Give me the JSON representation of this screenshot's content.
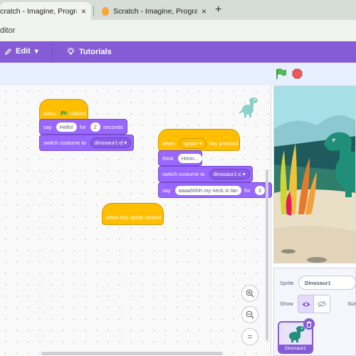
{
  "browser": {
    "tabs": [
      {
        "title": "cratch - Imagine, Program, Sh",
        "close": "×"
      },
      {
        "title": "Scratch - Imagine, Program, Sh",
        "close": "×"
      }
    ],
    "new_tab": "+",
    "address": "ditor"
  },
  "menubar": {
    "edit_label": "Edit",
    "edit_caret": "▾",
    "tutorials_label": "Tutorials"
  },
  "scripts": {
    "script1": {
      "hat_when": "when",
      "hat_clicked": "clicked",
      "say": "say",
      "say_text": "Hello!",
      "for": "for",
      "seconds_value": "2",
      "seconds": "seconds",
      "switch_costume": "switch costume to",
      "costume": "dinosaur1-d ▾"
    },
    "script2": {
      "when": "when",
      "key": "space ▾",
      "key_pressed": "key pressed",
      "think": "think",
      "think_text": "Hmm...",
      "switch_costume": "switch costume to",
      "costume": "dinosaur1-c ▾",
      "say": "say",
      "say_text": "aaaahhhh my neck is tan",
      "for": "for",
      "seconds_value": "2"
    },
    "script3": {
      "label": "when this sprite clicked"
    }
  },
  "zoom": {
    "in": "+",
    "out": "−",
    "reset": "="
  },
  "sprite_panel": {
    "sprite_label": "Sprite",
    "sprite_name": "Dinosaur1",
    "show_label": "Show",
    "size_label": "Size",
    "thumb_label": "Dinosaur1"
  },
  "colors": {
    "menu": "#855cd6",
    "events": "#ffbf00",
    "looks": "#9966ff"
  }
}
